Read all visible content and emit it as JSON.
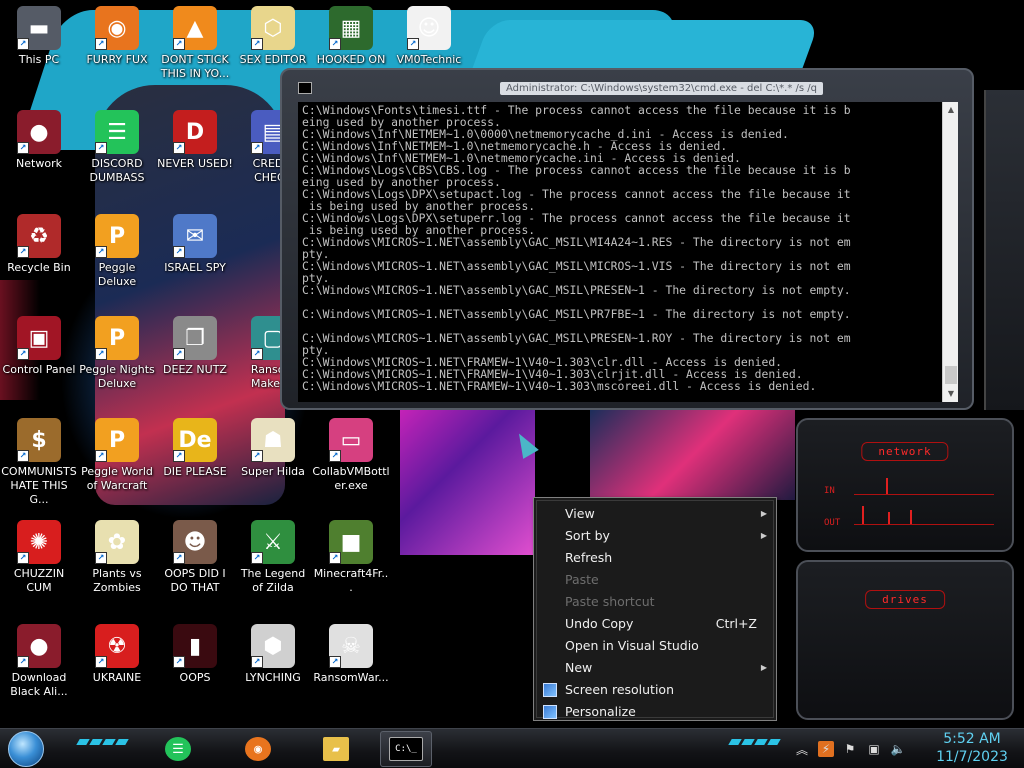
{
  "desktop_icons": [
    {
      "label": "This PC",
      "icon": "this-pc-icon",
      "color": "#555b66"
    },
    {
      "label": "FURRY FUX",
      "icon": "firefox-icon",
      "color": "#e8741e"
    },
    {
      "label": "DONT STICK THIS IN YO...",
      "icon": "vlc-cone-icon",
      "color": "#f08a1c"
    },
    {
      "label": "SEX EDITOR",
      "icon": "hex-editor-icon",
      "color": "#e8d68c"
    },
    {
      "label": "HOOKED ON",
      "icon": "hooked-on-icon",
      "color": "#2d6a2d"
    },
    {
      "label": "VM0Technic",
      "icon": "doctor-icon",
      "color": "#f2f2f2"
    },
    {
      "label": "Network",
      "icon": "network-icon",
      "color": "#8a1c2c"
    },
    {
      "label": "DISCORD DUMBASS",
      "icon": "discord-icon",
      "color": "#23c35a"
    },
    {
      "label": "NEVER USED!",
      "icon": "dev-cpp-icon",
      "color": "#c41e1e"
    },
    {
      "label": "CREDIT CHECK",
      "icon": "credit-check-icon",
      "color": "#4a5cc0"
    },
    {
      "label": "Recycle Bin",
      "icon": "recycle-bin-icon",
      "color": "#b02a2a"
    },
    {
      "label": "Peggle Deluxe",
      "icon": "peggle-icon",
      "color": "#f2a020"
    },
    {
      "label": "ISRAEL SPY",
      "icon": "israel-spy-icon",
      "color": "#4f79c8"
    },
    {
      "label": "Control Panel",
      "icon": "control-panel-icon",
      "color": "#a11525"
    },
    {
      "label": "Peggle Nights Deluxe",
      "icon": "peggle-nights-icon",
      "color": "#f2a020"
    },
    {
      "label": "DEEZ NUTZ",
      "icon": "deez-nutz-icon",
      "color": "#8a8a8a"
    },
    {
      "label": "Ransom Maker E",
      "icon": "ransom-maker-icon",
      "color": "#2f8f8f"
    },
    {
      "label": "COMMUNISTS HATE THIS G...",
      "icon": "money-bag-icon",
      "color": "#9b6b2c"
    },
    {
      "label": "Peggle World of Warcraft",
      "icon": "peggle-wow-icon",
      "color": "#f2a020"
    },
    {
      "label": "DIE PLEASE",
      "icon": "die-icon",
      "color": "#e8b51a"
    },
    {
      "label": "Super Hilda",
      "icon": "super-hilda-icon",
      "color": "#e8e0c0"
    },
    {
      "label": "CollabVMBottler.exe",
      "icon": "collab-vm-icon",
      "color": "#d64080"
    },
    {
      "label": "CHUZZIN CUM",
      "icon": "chuzzle-icon",
      "color": "#d81e1e"
    },
    {
      "label": "Plants vs Zombies",
      "icon": "pvz-icon",
      "color": "#e8e0b0"
    },
    {
      "label": "OOPS DID I DO THAT",
      "icon": "portrait-icon",
      "color": "#7a5a4a"
    },
    {
      "label": "The Legend of Zilda",
      "icon": "zelda-icon",
      "color": "#2f8f3f"
    },
    {
      "label": "Minecraft4Fr...",
      "icon": "minecraft-icon",
      "color": "#4f7f2f"
    },
    {
      "label": "Download Black Ali...",
      "icon": "alienware-icon",
      "color": "#8a1c2c"
    },
    {
      "label": "UKRAINE",
      "icon": "radiation-icon",
      "color": "#d81e1e"
    },
    {
      "label": "OOPS",
      "icon": "oops-icon",
      "color": "#3a0a10"
    },
    {
      "label": "LYNCHING",
      "icon": "lynching-icon",
      "color": "#d0d0d0"
    },
    {
      "label": "RansomWar...",
      "icon": "skull-icon",
      "color": "#e0e0e0"
    }
  ],
  "cmd": {
    "title": "Administrator: C:\\Windows\\system32\\cmd.exe - del  C:\\*.* /s /q",
    "lines": [
      "C:\\Windows\\Fonts\\timesi.ttf - The process cannot access the file because it is b",
      "eing used by another process.",
      "C:\\Windows\\Inf\\NETMEM~1.0\\0000\\netmemorycache_d.ini - Access is denied.",
      "C:\\Windows\\Inf\\NETMEM~1.0\\netmemorycache.h - Access is denied.",
      "C:\\Windows\\Inf\\NETMEM~1.0\\netmemorycache.ini - Access is denied.",
      "C:\\Windows\\Logs\\CBS\\CBS.log - The process cannot access the file because it is b",
      "eing used by another process.",
      "C:\\Windows\\Logs\\DPX\\setupact.log - The process cannot access the file because it",
      " is being used by another process.",
      "C:\\Windows\\Logs\\DPX\\setuperr.log - The process cannot access the file because it",
      " is being used by another process.",
      "C:\\Windows\\MICROS~1.NET\\assembly\\GAC_MSIL\\MI4A24~1.RES - The directory is not em",
      "pty.",
      "C:\\Windows\\MICROS~1.NET\\assembly\\GAC_MSIL\\MICROS~1.VIS - The directory is not em",
      "pty.",
      "C:\\Windows\\MICROS~1.NET\\assembly\\GAC_MSIL\\PRESEN~1 - The directory is not empty.",
      "",
      "C:\\Windows\\MICROS~1.NET\\assembly\\GAC_MSIL\\PR7FBE~1 - The directory is not empty.",
      "",
      "C:\\Windows\\MICROS~1.NET\\assembly\\GAC_MSIL\\PRESEN~1.ROY - The directory is not em",
      "pty.",
      "C:\\Windows\\MICROS~1.NET\\FRAMEW~1\\V40~1.303\\clr.dll - Access is denied.",
      "C:\\Windows\\MICROS~1.NET\\FRAMEW~1\\V40~1.303\\clrjit.dll - Access is denied.",
      "C:\\Windows\\MICROS~1.NET\\FRAMEW~1\\V40~1.303\\mscoreei.dll - Access is denied."
    ]
  },
  "gadgets": {
    "network": {
      "title": "network",
      "in_label": "IN",
      "out_label": "OUT"
    },
    "drives": {
      "title": "drives"
    }
  },
  "context_menu": {
    "items": [
      {
        "label": "View",
        "submenu": true,
        "disabled": false
      },
      {
        "label": "Sort by",
        "submenu": true,
        "disabled": false
      },
      {
        "label": "Refresh",
        "disabled": false
      },
      {
        "label": "Paste",
        "disabled": true
      },
      {
        "label": "Paste shortcut",
        "disabled": true
      },
      {
        "label": "Undo Copy",
        "shortcut": "Ctrl+Z",
        "disabled": false
      },
      {
        "label": "Open in Visual Studio",
        "disabled": false
      },
      {
        "label": "New",
        "submenu": true,
        "disabled": false
      },
      {
        "label": "Screen resolution",
        "icon": "screen-resolution-icon",
        "disabled": false
      },
      {
        "label": "Personalize",
        "icon": "personalize-icon",
        "disabled": false
      }
    ]
  },
  "taskbar": {
    "apps": [
      {
        "name": "Discord",
        "icon": "discord-icon",
        "color": "#23c35a"
      },
      {
        "name": "Firefox",
        "icon": "firefox-icon",
        "color": "#e8741e"
      },
      {
        "name": "File Explorer",
        "icon": "folder-icon",
        "color": "#e8c04a"
      },
      {
        "name": "Command Prompt",
        "icon": "cmd-icon",
        "color": "#000000",
        "active": true
      }
    ],
    "clock": {
      "time": "5:52 AM",
      "date": "11/7/2023"
    }
  }
}
